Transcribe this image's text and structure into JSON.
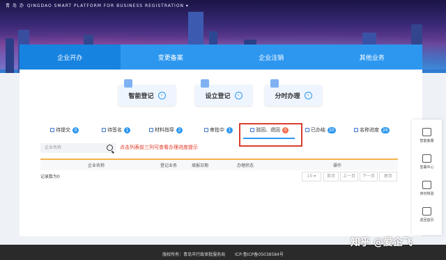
{
  "header": {
    "brand_cn": "青 岛 办",
    "brand_en": "QINGDAO SMART PLATFORM FOR BUSINESS REGISTRATION ▾"
  },
  "nav": {
    "items": [
      "企业开办",
      "变更备案",
      "企业注销",
      "其他业务"
    ],
    "active": 0
  },
  "cards": [
    "智能登记",
    "设立登记",
    "分时办理"
  ],
  "tabs": [
    {
      "label": "待提交",
      "count": "0"
    },
    {
      "label": "待签名",
      "count": "1"
    },
    {
      "label": "材料指导",
      "count": "2"
    },
    {
      "label": "审批中",
      "count": "1"
    },
    {
      "label": "驳回、退回",
      "count": "0"
    },
    {
      "label": "已办结",
      "count": "20"
    },
    {
      "label": "名称进度",
      "count": "26"
    }
  ],
  "search": {
    "placeholder": "企业名称"
  },
  "tip": "点击列表前三列可查看办理进度提示",
  "table": {
    "columns": [
      "企业名称",
      "登记业务",
      "填报日期",
      "办理状态",
      "操作"
    ]
  },
  "record_count": "记录数为0",
  "pager": {
    "size": "10",
    "first": "首页",
    "prev": "上一页",
    "next": "下一页",
    "last": "尾页"
  },
  "sidebar": [
    "智能客服",
    "签署中心",
    "身份核验",
    "返回首页"
  ],
  "footer": {
    "rights": "版权所有：青岛市行政审批服务局",
    "icp": "ICP:鲁ICP备05038584号"
  },
  "watermark": "知乎 @爱企飞"
}
